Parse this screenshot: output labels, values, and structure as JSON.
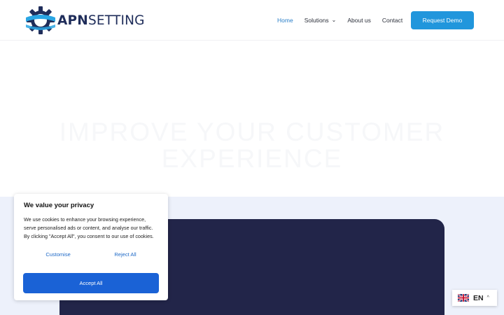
{
  "logo": {
    "part1": "APN",
    "part2": "SETTING",
    "icon": "gear-logo-icon"
  },
  "nav": {
    "items": [
      {
        "label": "Home",
        "active": true
      },
      {
        "label": "Solutions",
        "has_dropdown": true,
        "icon": "chevron-down-icon"
      },
      {
        "label": "About us"
      },
      {
        "label": "Contact"
      }
    ],
    "cta": "Request Demo"
  },
  "hero": {
    "title_line1": "IMPROVE YOUR CUSTOMER",
    "title_line2": "EXPERIENCE"
  },
  "cookie": {
    "title": "We value your privacy",
    "body": "We use cookies to enhance your browsing experience, serve personalised ads or content, and analyse our traffic. By clicking \"Accept All\", you consent to our use of cookies.",
    "customise": "Customise",
    "reject": "Reject All",
    "accept": "Accept All"
  },
  "language": {
    "code": "EN",
    "flag": "uk-flag-icon",
    "caret": "^"
  },
  "colors": {
    "accent": "#2196dc",
    "nav_active": "#2a7fc9",
    "dark_card": "#222549",
    "band": "#edf1fb",
    "accept": "#1a62d6"
  }
}
